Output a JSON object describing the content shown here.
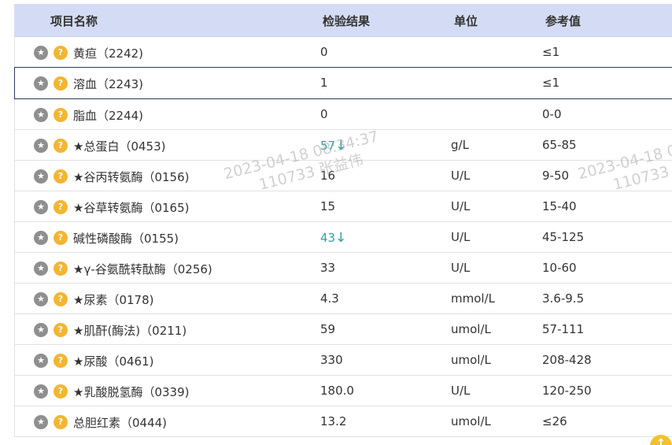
{
  "header": {
    "name": "项目名称",
    "result": "检验结果",
    "unit": "单位",
    "ref": "参考值"
  },
  "rows": [
    {
      "name": "黄疸（2242)",
      "result": "0",
      "arrow": "",
      "unit": "",
      "ref": "≤1",
      "low": false
    },
    {
      "name": "溶血（2243)",
      "result": "1",
      "arrow": "",
      "unit": "",
      "ref": "≤1",
      "low": false
    },
    {
      "name": "脂血（2244)",
      "result": "0",
      "arrow": "",
      "unit": "",
      "ref": "0-0",
      "low": false
    },
    {
      "name": "★总蛋白（0453)",
      "result": "57",
      "arrow": "↓",
      "unit": "g/L",
      "ref": "65-85",
      "low": true
    },
    {
      "name": "★谷丙转氨酶（0156)",
      "result": "16",
      "arrow": "",
      "unit": "U/L",
      "ref": "9-50",
      "low": false
    },
    {
      "name": "★谷草转氨酶（0165)",
      "result": "15",
      "arrow": "",
      "unit": "U/L",
      "ref": "15-40",
      "low": false
    },
    {
      "name": "碱性磷酸酶（0155)",
      "result": "43",
      "arrow": "↓",
      "unit": "U/L",
      "ref": "45-125",
      "low": true
    },
    {
      "name": "★γ-谷氨酰转酞酶（0256)",
      "result": "33",
      "arrow": "",
      "unit": "U/L",
      "ref": "10-60",
      "low": false
    },
    {
      "name": "★尿素（0178)",
      "result": "4.3",
      "arrow": "",
      "unit": "mmol/L",
      "ref": "3.6-9.5",
      "low": false
    },
    {
      "name": "★肌酐(酶法)（0211)",
      "result": "59",
      "arrow": "",
      "unit": "umol/L",
      "ref": "57-111",
      "low": false
    },
    {
      "name": "★尿酸（0461)",
      "result": "330",
      "arrow": "",
      "unit": "umol/L",
      "ref": "208-428",
      "low": false
    },
    {
      "name": "★乳酸脱氢酶（0339)",
      "result": "180.0",
      "arrow": "",
      "unit": "U/L",
      "ref": "120-250",
      "low": false
    },
    {
      "name": "总胆红素（0444)",
      "result": "13.2",
      "arrow": "",
      "unit": "umol/L",
      "ref": "≤26",
      "low": false
    }
  ],
  "icons": {
    "star": "star-icon",
    "help": "help-icon",
    "star_glyph": "★",
    "help_glyph": "?"
  },
  "watermarks": [
    {
      "line1": "2023-04-18 08:34:37",
      "line2": "110733 张益伟"
    },
    {
      "line1": "2023-04-18 0",
      "line2": "110733 张"
    }
  ],
  "colors": {
    "header_bg": "#d4dcf5",
    "low_result": "#2aa3a3",
    "help_icon": "#f2b632",
    "star_icon": "#8f8f8f"
  }
}
